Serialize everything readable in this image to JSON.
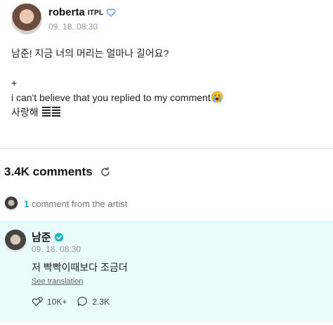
{
  "post": {
    "author": "roberta",
    "author_tag": "ITPL",
    "timestamp": "09. 18. 08:30",
    "lines": [
      "남준! 지금 너의 머리는 얼마나 길어요?",
      "",
      "+",
      "i can't believe that you replied to my comment",
      "사랑해"
    ],
    "emoji_icon": "loudly-crying-face-icon"
  },
  "comments": {
    "count_label": "3.4K comments",
    "artist_filter": {
      "count": "1",
      "label": "comment from the artist"
    }
  },
  "artist_comment": {
    "author": "남준",
    "timestamp": "09. 18. 08:30",
    "text": "저 빡빡이때보다 조금더",
    "translate_label": "See translation",
    "likes": "10K+",
    "replies": "2.3K"
  },
  "colors": {
    "accent": "#1fb6c1",
    "highlight_bg": "#e9fbfa"
  }
}
